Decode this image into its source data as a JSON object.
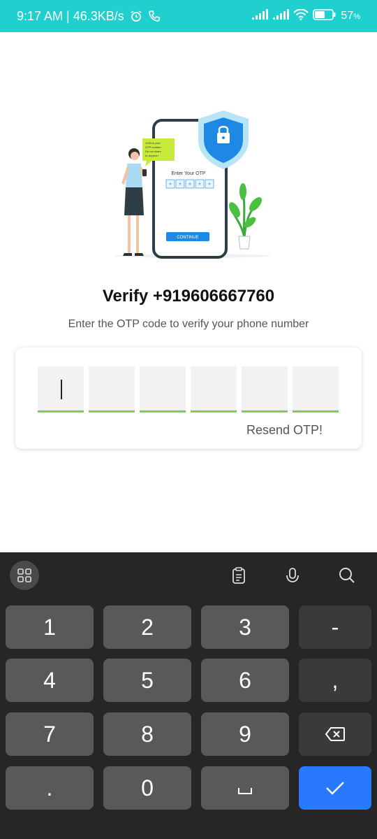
{
  "status": {
    "time": "9:17 AM | 46.3KB/s",
    "battery": "57"
  },
  "screen": {
    "title": "Verify +919606667760",
    "subtitle": "Enter the OTP code to verify your phone number",
    "resend": "Resend OTP!",
    "otp_digits": [
      "",
      "",
      "",
      "",
      "",
      ""
    ]
  },
  "illustration": {
    "screen_label": "Enter Your OTP",
    "button_label": "CONTINUE",
    "bubble_text": "1234 is your OTP number. Do not share to anyone!"
  },
  "keyboard": {
    "rows": [
      [
        "1",
        "2",
        "3",
        "-"
      ],
      [
        "4",
        "5",
        "6",
        ","
      ],
      [
        "7",
        "8",
        "9",
        ""
      ],
      [
        ".",
        "0",
        "",
        ""
      ]
    ]
  },
  "colors": {
    "status_bar": "#1fd0cf",
    "accent_green": "#7ccf4a",
    "keyboard_bg": "#262626",
    "enter_key": "#2979ff"
  },
  "icons": {
    "status": [
      "alarm-icon",
      "call-icon",
      "signal-icon",
      "signal-icon",
      "wifi-icon",
      "battery-icon"
    ],
    "keyboard_toolbar": [
      "apps-grid-icon",
      "clipboard-icon",
      "microphone-icon",
      "search-icon"
    ],
    "keys": [
      "space-icon",
      "backspace-icon",
      "check-icon"
    ]
  }
}
